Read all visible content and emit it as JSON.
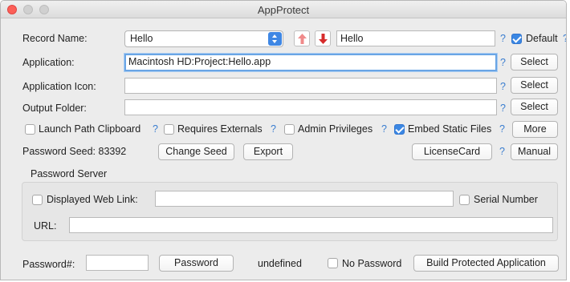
{
  "window": {
    "title": "AppProtect"
  },
  "record": {
    "label": "Record Name:",
    "popup_value": "Hello",
    "name_value": "Hello",
    "default_label": "Default",
    "default_checked": true
  },
  "application": {
    "label": "Application:",
    "value": "Macintosh HD:Project:Hello.app",
    "select_label": "Select"
  },
  "icon": {
    "label": "Application Icon:",
    "value": "",
    "select_label": "Select"
  },
  "output": {
    "label": "Output Folder:",
    "value": "",
    "select_label": "Select"
  },
  "options": {
    "launch_path": "Launch Path Clipboard",
    "requires_externals": "Requires Externals",
    "admin_privileges": "Admin Privileges",
    "embed_static": "Embed Static Files",
    "more_label": "More"
  },
  "seed": {
    "label": "Password Seed: 83392",
    "change_label": "Change Seed",
    "export_label": "Export",
    "license_label": "LicenseCard",
    "manual_label": "Manual"
  },
  "server": {
    "group_title": "Password Server",
    "web_link_label": "Displayed Web Link:",
    "web_link_value": "",
    "serial_label": "Serial Number",
    "url_label": "URL:",
    "url_value": ""
  },
  "bottom": {
    "password_label": "Password#:",
    "password_value": "",
    "password_button": "Password",
    "undefined_text": "undefined",
    "no_password_label": "No Password",
    "build_label": "Build Protected Application"
  },
  "help_glyph": "?",
  "icons": {
    "up": "up-arrow-icon",
    "down": "down-arrow-icon"
  },
  "colors": {
    "accent": "#3b87e3",
    "help": "#3b7ed0",
    "up_arrow": "#f08a8a",
    "down_arrow": "#d62b2b"
  }
}
